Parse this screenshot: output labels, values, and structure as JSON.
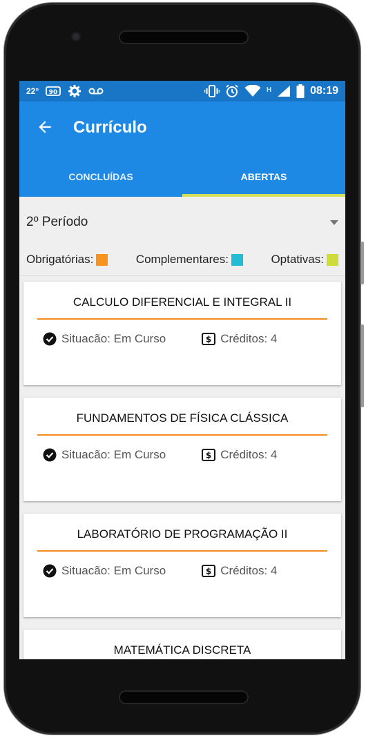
{
  "status_bar": {
    "temperature": "22°",
    "time": "08:19",
    "network_letter": "H",
    "icons": [
      "ppp-icon",
      "settings-icon",
      "voicemail-icon",
      "vibrate-icon",
      "alarm-icon",
      "wifi-icon",
      "signal-icon",
      "battery-icon"
    ]
  },
  "app_bar": {
    "title": "Currículo",
    "back_icon": "arrow-left-icon"
  },
  "tabs": [
    {
      "label": "CONCLUÍDAS",
      "selected": false
    },
    {
      "label": "ABERTAS",
      "selected": true
    }
  ],
  "period_select": {
    "selected": "2º Período"
  },
  "legend": [
    {
      "label": "Obrigatórias:",
      "color": "#f7931e"
    },
    {
      "label": "Complementares:",
      "color": "#22bcd4"
    },
    {
      "label": "Optativas:",
      "color": "#cddc39"
    }
  ],
  "courses": [
    {
      "name": "CALCULO DIFERENCIAL E INTEGRAL II",
      "status": "Situacão: Em Curso",
      "credits": "Créditos: 4"
    },
    {
      "name": "FUNDAMENTOS DE FÍSICA CLÁSSICA",
      "status": "Situacão: Em Curso",
      "credits": "Créditos: 4"
    },
    {
      "name": "LABORATÓRIO DE PROGRAMAÇÃO II",
      "status": "Situacão: Em Curso",
      "credits": "Créditos: 4"
    },
    {
      "name": "MATEMÁTICA DISCRETA",
      "status": "",
      "credits": ""
    }
  ],
  "colors": {
    "primary": "#1e88e5",
    "status_bar": "#1976c6",
    "tab_indicator": "#d4e157",
    "card_rule": "#f28c1e"
  }
}
